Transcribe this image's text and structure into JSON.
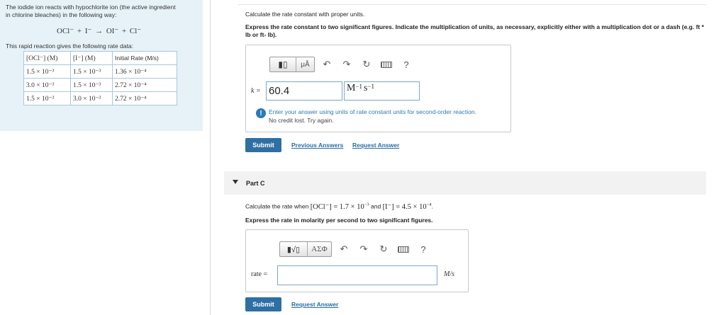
{
  "left": {
    "intro": "The iodide ion reacts with hypochlorite ion (the active ingredient in chlorine bleaches) in the following way:",
    "equation": "OCl⁻ + I⁻ → OI⁻ + Cl⁻",
    "rate_intro": "This rapid reaction gives the following rate data:",
    "table": {
      "headers": [
        "[OCl⁻] (M)",
        "[I⁻] (M)",
        "Initial Rate (M/s)"
      ],
      "rows": [
        [
          "1.5 × 10⁻³",
          "1.5 × 10⁻³",
          "1.36 × 10⁻⁴"
        ],
        [
          "3.0 × 10⁻³",
          "1.5 × 10⁻³",
          "2.72 × 10⁻⁴"
        ],
        [
          "1.5 × 10⁻³",
          "3.0 × 10⁻³",
          "2.72 × 10⁻⁴"
        ]
      ]
    }
  },
  "partB": {
    "question": "Calculate the rate constant with proper units.",
    "instruction": "Express the rate constant to two significant figures. Indicate the multiplication of units, as necessary, explicitly either with a multiplication dot or a dash (e.g. ft * lb or ft- lb).",
    "toolbar": {
      "templates_label": "▮▯",
      "units_label": "μÅ",
      "undo_glyph": "↶",
      "redo_glyph": "↷",
      "reset_glyph": "↻",
      "help_glyph": "?"
    },
    "label": "k =",
    "value": "60.4",
    "units_base": "M",
    "units_exp1": "−1",
    "units_base2": "s",
    "units_exp2": "−1",
    "feedback": "Enter your answer using units of rate constant units for second-order reaction.",
    "feedback_sub": "No credit lost. Try again.",
    "submit_label": "Submit",
    "previous_answers": "Previous Answers",
    "request_answer": "Request Answer"
  },
  "partC": {
    "title": "Part C",
    "question_pre": "Calculate the rate when",
    "cond1": "[OCl⁻] = 1.7 × 10",
    "cond1_exp": "−3",
    "and": "and",
    "cond2": "[I⁻] = 4.5 × 10",
    "cond2_exp": "−4",
    "instruction": "Express the rate in molarity per second to two significant figures.",
    "toolbar": {
      "templates_label": "▮√▯",
      "greek_label": "ΑΣΦ",
      "undo_glyph": "↶",
      "redo_glyph": "↷",
      "reset_glyph": "↻",
      "help_glyph": "?"
    },
    "label": "rate =",
    "value": "",
    "units": "M/s",
    "submit_label": "Submit",
    "request_answer": "Request Answer"
  },
  "colors": {
    "accent": "#2e6fa4",
    "panel": "#e6f2f8",
    "link": "#2a6da8"
  }
}
